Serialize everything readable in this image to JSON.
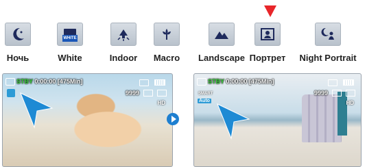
{
  "modes": [
    {
      "label": "Ночь",
      "icon": "night-moon-icon"
    },
    {
      "label": "White",
      "icon": "white-balance-icon",
      "badge": "WHITE"
    },
    {
      "label": "Indoor",
      "icon": "indoor-lamp-icon"
    },
    {
      "label": "Macro",
      "icon": "macro-flower-icon"
    },
    {
      "label": "Landscape",
      "icon": "landscape-mountain-icon"
    },
    {
      "label": "Портрет",
      "icon": "portrait-icon"
    },
    {
      "label": "Night Portrait",
      "icon": "night-portrait-icon"
    }
  ],
  "selected_mode": "Портрет",
  "colors": {
    "accent": "#e8262a",
    "status_green": "#39d13a",
    "highlight_blue": "#2c9bd6"
  },
  "screens": {
    "before": {
      "status": "STBY",
      "time": "0:00:00 [475Min]",
      "count": "9999"
    },
    "after": {
      "status": "STBY",
      "time": "0:00:00 [475Min]",
      "count": "9999",
      "smart": "SMART",
      "auto": "Auto"
    }
  }
}
